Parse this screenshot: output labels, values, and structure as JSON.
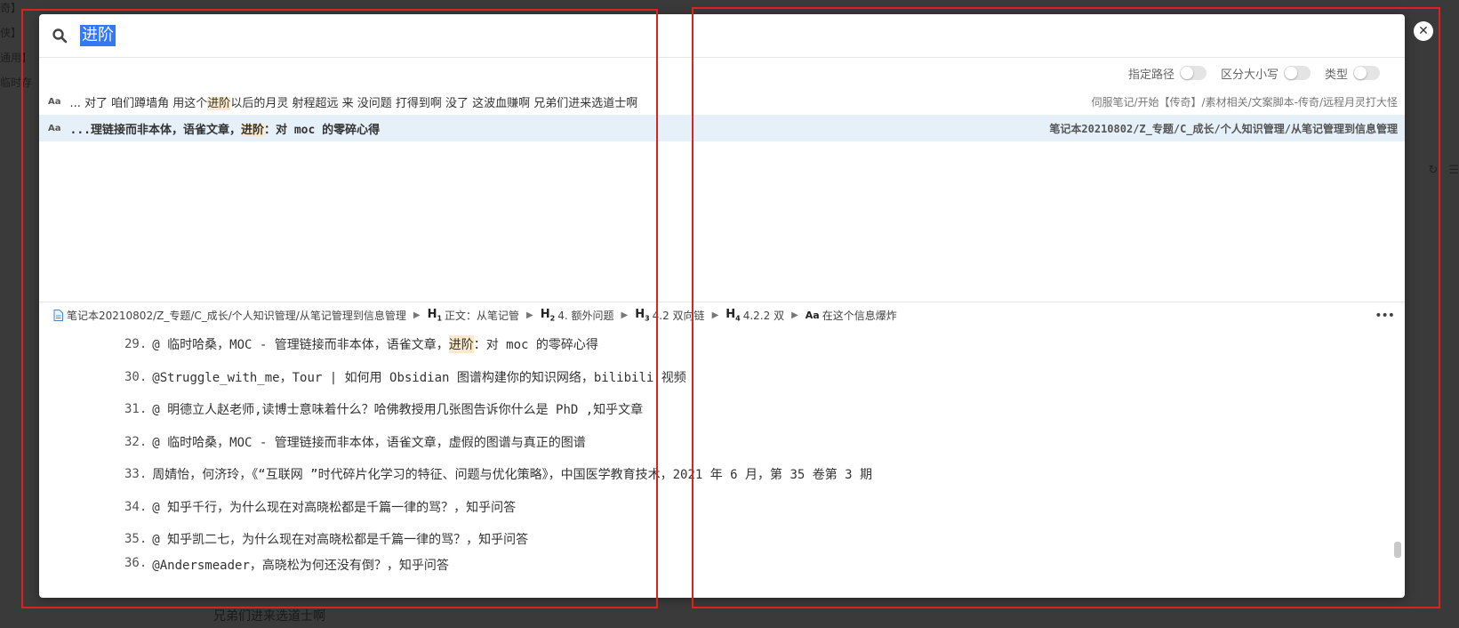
{
  "background": {
    "left_items": [
      "奇】",
      "侠】",
      "通用】",
      "临时存"
    ],
    "bottom_text": "兄弟们进来选道士啊"
  },
  "search": {
    "value": "进阶",
    "icon": "search-icon"
  },
  "options": [
    {
      "label": "指定路径",
      "on": false
    },
    {
      "label": "区分大小写",
      "on": false
    },
    {
      "label": "类型",
      "on": false
    }
  ],
  "results": [
    {
      "type_badge": "Aa",
      "prefix": "... 对了  咱们蹲墙角  用这个",
      "match": "进阶",
      "suffix": "以后的月灵  射程超远  来  没问题  打得到啊  没了  这波血赚啊  兄弟们进来选道士啊",
      "path": "伺服笔记/开始【传奇】/素材相关/文案脚本-传奇/远程月灵打大怪",
      "selected": false
    },
    {
      "type_badge": "Aa",
      "prefix": "...理链接而非本体，语雀文章，",
      "match": "进阶",
      "suffix": "：对 moc 的零碎心得",
      "path": "笔记本20210802/Z_专题/C_成长/个人知识管理/从笔记管理到信息管理",
      "selected": true
    }
  ],
  "breadcrumb": {
    "file": "笔记本20210802/Z_专题/C_成长/个人知识管理/从笔记管理到信息管理",
    "h1": "正文：从笔记管",
    "h2": "4. 额外问题",
    "h3": "4.2 双向链",
    "h4": "4.2.2 双",
    "aa": "在这个信息爆炸",
    "more": "•••"
  },
  "preview_lines": [
    {
      "num": "29.",
      "prefix": "@ 临时哈桑，MOC - 管理链接而非本体，语雀文章，",
      "match": "进阶",
      "suffix": "：对 moc 的零碎心得"
    },
    {
      "num": "30.",
      "prefix": "@Struggle_with_me，Tour | 如何用 Obsidian 图谱构建你的知识网络，bilibili 视频",
      "match": "",
      "suffix": ""
    },
    {
      "num": "31.",
      "prefix": "@ 明德立人赵老师,读博士意味着什么？哈佛教授用几张图告诉你什么是 PhD ,知乎文章",
      "match": "",
      "suffix": ""
    },
    {
      "num": "32.",
      "prefix": "@ 临时哈桑，MOC - 管理链接而非本体，语雀文章，虚假的图谱与真正的图谱",
      "match": "",
      "suffix": ""
    },
    {
      "num": "33.",
      "prefix": "周婧怡，何济玲，《“互联网 ”时代碎片化学习的特征、问题与优化策略》，中国医学教育技术，2021 年 6 月，第 35 卷第 3 期",
      "match": "",
      "suffix": ""
    },
    {
      "num": "34.",
      "prefix": "@ 知乎千行，为什么现在对高晓松都是千篇一律的骂？，知乎问答",
      "match": "",
      "suffix": ""
    },
    {
      "num": "35.",
      "prefix": "@ 知乎凯二七，为什么现在对高晓松都是千篇一律的骂？，知乎问答",
      "match": "",
      "suffix": ""
    },
    {
      "num": "36.",
      "prefix": "@Andersmeader，高晓松为何还没有倒？，知乎问答",
      "match": "",
      "suffix": ""
    }
  ],
  "close_icon": "close-icon",
  "colors": {
    "selection": "#3478f6",
    "highlight": "#fbe9c8",
    "selected_row": "#e6f0f8",
    "annotation_box": "#e0201f"
  }
}
